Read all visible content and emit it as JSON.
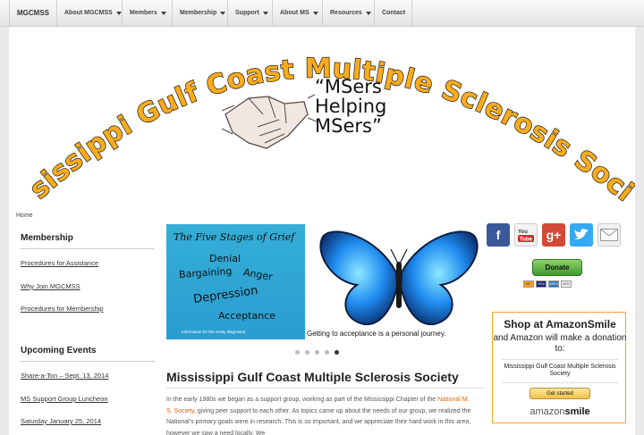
{
  "nav": {
    "brand": "MGCMSS",
    "items": [
      {
        "label": "About MGCMSS",
        "dropdown": true
      },
      {
        "label": "Members",
        "dropdown": true
      },
      {
        "label": "Membership",
        "dropdown": true
      },
      {
        "label": "Support",
        "dropdown": true
      },
      {
        "label": "About MS",
        "dropdown": true
      },
      {
        "label": "Resources",
        "dropdown": true
      },
      {
        "label": "Contact",
        "dropdown": false
      }
    ]
  },
  "banner": {
    "arc_title": "Mississippi Gulf Coast Multiple Sclerosis Society",
    "tagline": [
      "“MSers",
      "Helping",
      "MSers”"
    ]
  },
  "breadcrumb": "Home",
  "sidebar": {
    "membership_heading": "Membership",
    "membership_links": [
      "Procedures for Assistance",
      "Why Join MGCMSS",
      "Procedures for Membership"
    ],
    "events_heading": "Upcoming Events",
    "event_links": [
      "Share-a-Ton – Sept. 13, 2014",
      "MS Support Group Luncheon",
      "Saturday January 25, 2014"
    ]
  },
  "slider": {
    "grief_title": "The Five Stages of Grief",
    "stages": [
      "Denial",
      "Anger",
      "Bargaining",
      "Depression",
      "Acceptance"
    ],
    "grief_footer": "Information for the newly diagnosed",
    "caption": "Getting to acceptance is a personal journey.",
    "slide_count": 5,
    "active_slide": 5
  },
  "content": {
    "title": "Mississippi Gulf Coast Multiple Sclerosis Society",
    "para_start": "In the early 1980s we began as a support group, working as part of the Mississippi Chapter of the ",
    "para_link": "National M. S. Society",
    "para_end": ", giving peer support to each other. As topics came up about the needs of our group, we realized the National’s primary goals were in research. This is so important, and we appreciate their hard work in this area, however we saw a need locally. We"
  },
  "social": [
    "facebook-icon",
    "youtube-icon",
    "google-plus-icon",
    "twitter-icon",
    "email-icon"
  ],
  "donate": {
    "label": "Donate",
    "cards": [
      "MC",
      "VISA",
      "AMEX",
      "DISC"
    ]
  },
  "amazon": {
    "heading": "Shop at AmazonSmile",
    "subheading": "and Amazon will make a donation to:",
    "org": "Mississippi Gulf Coast Multiple Sclerosis Society",
    "button": "Get started",
    "logo_word": "amazon",
    "logo_smile": "smile"
  },
  "colors": {
    "banner_text": "#fbab1c",
    "link": "#e0640c",
    "amazon_border": "#f5a623"
  }
}
